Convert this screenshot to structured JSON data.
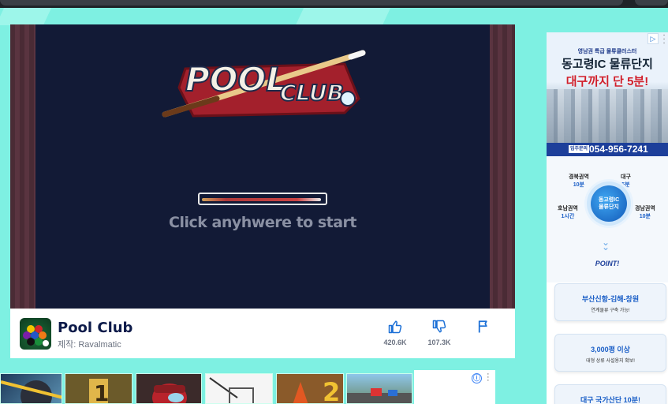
{
  "game": {
    "logo_word1": "POOL",
    "logo_word2": "CLUB",
    "loading_progress": 0.42,
    "start_prompt": "Click anyhwere to start"
  },
  "info": {
    "title": "Pool Club",
    "author": "제작: Ravalmatic",
    "likes": "420.6K",
    "dislikes": "107.3K"
  },
  "ad_right": {
    "small_line": "영남권 특급 물류클러스터",
    "headline1": "동고령IC 물류단지",
    "headline2": "대구까지 단 5분!",
    "phone_tag": "입주문의",
    "phone": "054-956-7241",
    "hub_label_1": "동고령IC",
    "hub_label_2": "물류단지",
    "regions": [
      {
        "name": "경북권역",
        "time": "10분"
      },
      {
        "name": "대구",
        "time": "5분"
      },
      {
        "name": "호남권역",
        "time": "1시간"
      },
      {
        "name": "경남권역",
        "time": "10분"
      }
    ],
    "point": "POINT!",
    "cards": [
      {
        "headline": "부산신항-김해-창원",
        "sub": "연계물류 구축 가능!"
      },
      {
        "headline": "3,000평 이상",
        "sub": "대형 상류 사설용지 확보!"
      },
      {
        "headline": "대구 국가산단 10분!",
        "sub": ""
      }
    ]
  },
  "ad_small": {
    "info_icon": "ⓘ"
  },
  "colors": {
    "page_bg": "#7ef0e2",
    "canvas_bg": "#121a36",
    "title_navy": "#0d1b4a",
    "action_blue": "#1b6fd6"
  }
}
